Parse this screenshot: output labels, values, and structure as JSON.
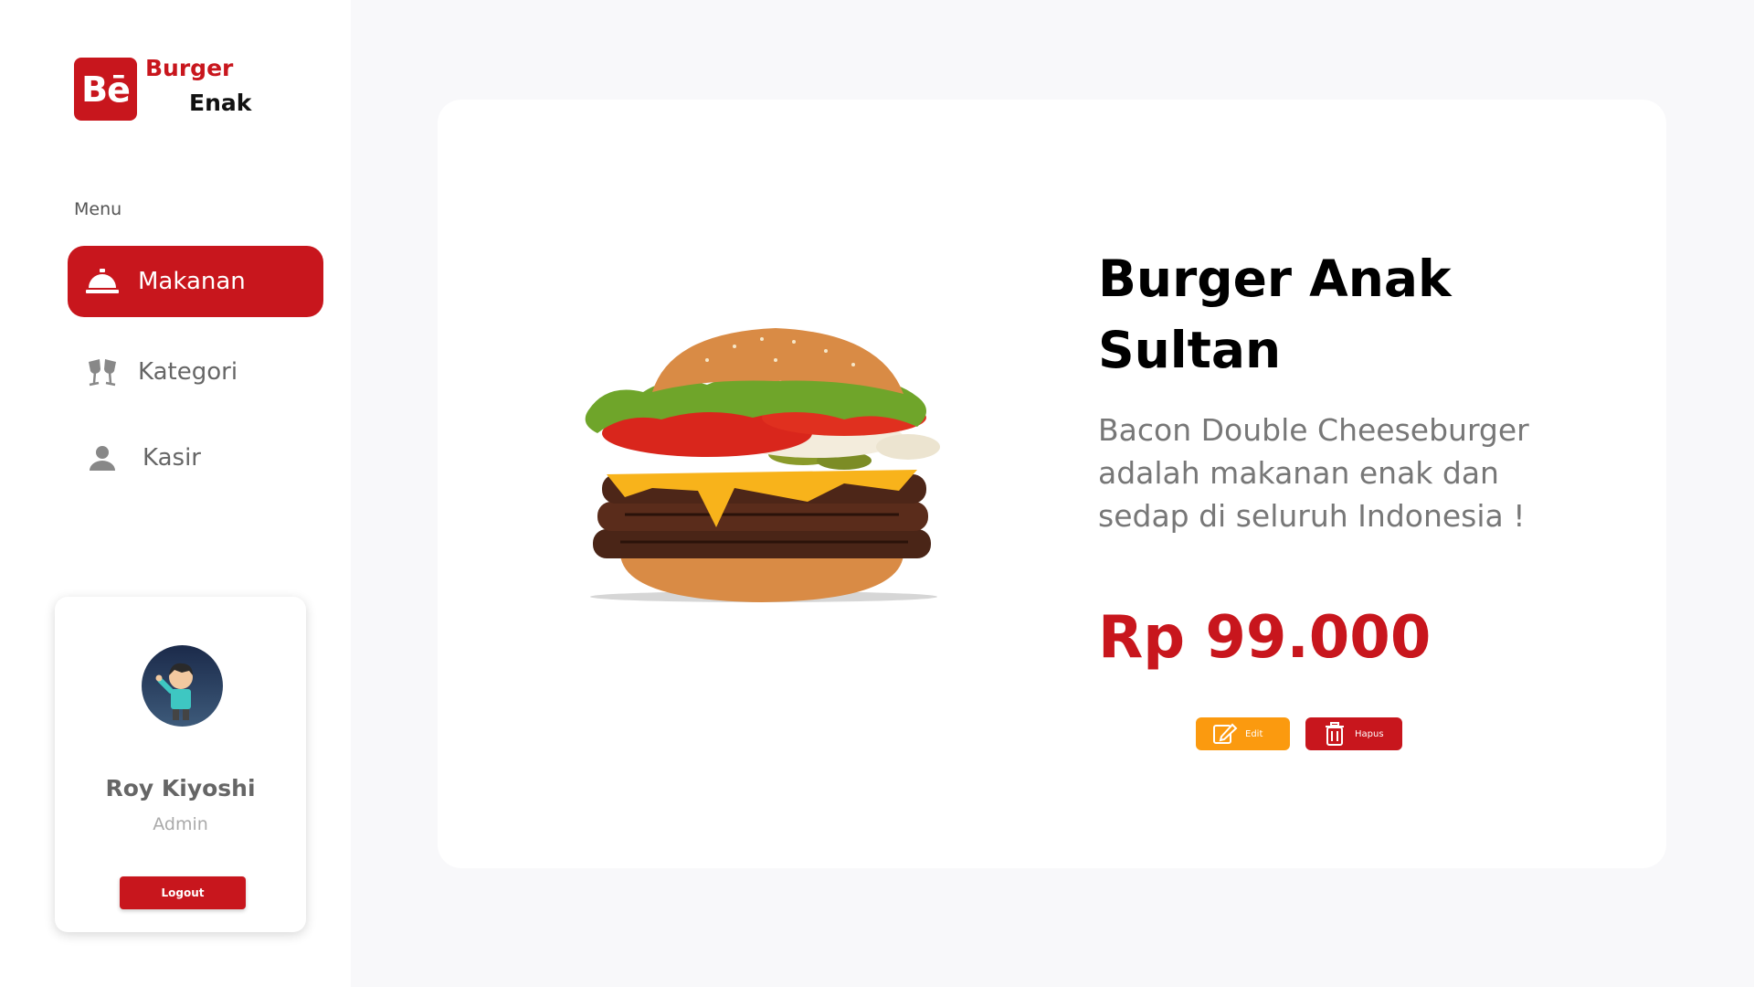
{
  "brand": {
    "badge": "Bē",
    "line1": "Burger",
    "line2": "Enak"
  },
  "sidebar": {
    "heading": "Menu",
    "items": [
      {
        "label": "Makanan",
        "icon": "service-bell-icon",
        "active": true
      },
      {
        "label": "Kategori",
        "icon": "cheers-glasses-icon",
        "active": false
      },
      {
        "label": "Kasir",
        "icon": "user-icon",
        "active": false
      }
    ]
  },
  "profile": {
    "name": "Roy Kiyoshi",
    "role": "Admin",
    "logout_label": "Logout",
    "avatar_icon": "avatar-character-icon"
  },
  "product": {
    "title": "Burger Anak Sultan",
    "description": "Bacon Double Cheeseburger adalah makanan enak dan sedap di seluruh Indonesia !",
    "price": "Rp 99.000",
    "image_icon": "burger-image",
    "edit_label": "Edit",
    "delete_label": "Hapus"
  },
  "colors": {
    "primary": "#c8161d",
    "edit": "#fb9a0f",
    "background": "#f8f8fa"
  }
}
